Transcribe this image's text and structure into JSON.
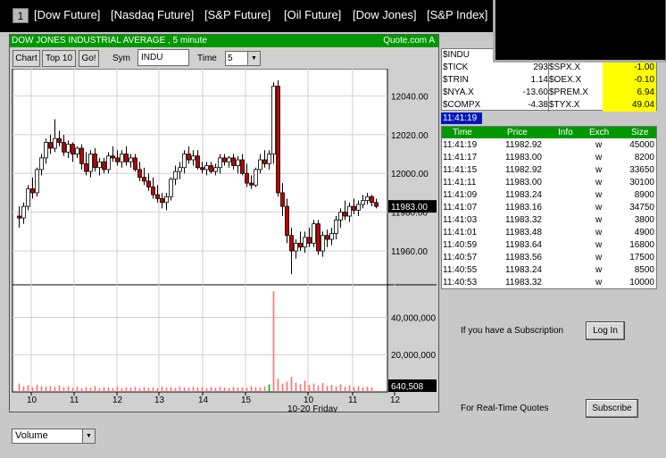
{
  "nav": {
    "tab_number": "1",
    "links": [
      "[Dow Future]",
      "[Nasdaq Future]",
      "[S&P Future]",
      "[Oil Future]",
      "[Dow Jones]",
      "[S&P Index]"
    ]
  },
  "chart_panel": {
    "title": "DOW JONES INDUSTRIAL AVERAGE  , 5 minute",
    "source": "Quote.com  A",
    "buttons": {
      "chart": "Chart",
      "top10": "Top 10",
      "go": "Go!"
    },
    "sym_label": "Sym",
    "sym_value": "INDU",
    "time_label": "Time",
    "time_value": "5",
    "indicator_select": "Volume"
  },
  "chart_data": {
    "type": "candlestick",
    "title": "DOW JONES INDUSTRIAL AVERAGE  , 5 minute",
    "price_ticks": [
      12040,
      12020,
      12000,
      11980,
      11960
    ],
    "price_tick_labels": [
      "12040.00",
      "12020.00",
      "12000.00",
      "11980.00",
      "11960.00"
    ],
    "ylim": [
      11943,
      12054
    ],
    "last_price_label": "11983.00",
    "volume_ticks": [
      40000000,
      20000000
    ],
    "volume_tick_labels": [
      "40,000,000",
      "20,000,000"
    ],
    "volume_ylim": [
      0,
      57000000
    ],
    "last_volume_label": "640,508",
    "x_tick_labels": [
      "10",
      "11",
      "12",
      "13",
      "14",
      "15",
      "10",
      "11",
      "12"
    ],
    "date_label": "10-20 Friday",
    "grid": true,
    "candles": [
      {
        "o": 11978,
        "h": 11983,
        "l": 11972,
        "c": 11977
      },
      {
        "o": 11977,
        "h": 11985,
        "l": 11974,
        "c": 11983
      },
      {
        "o": 11983,
        "h": 11994,
        "l": 11981,
        "c": 11992
      },
      {
        "o": 11992,
        "h": 11998,
        "l": 11987,
        "c": 11990
      },
      {
        "o": 11990,
        "h": 12003,
        "l": 11988,
        "c": 12002
      },
      {
        "o": 12002,
        "h": 12010,
        "l": 11999,
        "c": 12008
      },
      {
        "o": 12008,
        "h": 12018,
        "l": 12005,
        "c": 12016
      },
      {
        "o": 12016,
        "h": 12020,
        "l": 12010,
        "c": 12013
      },
      {
        "o": 12013,
        "h": 12028,
        "l": 12011,
        "c": 12018
      },
      {
        "o": 12018,
        "h": 12022,
        "l": 12014,
        "c": 12016
      },
      {
        "o": 12016,
        "h": 12020,
        "l": 12009,
        "c": 12011
      },
      {
        "o": 12011,
        "h": 12017,
        "l": 12008,
        "c": 12015
      },
      {
        "o": 12015,
        "h": 12016,
        "l": 12006,
        "c": 12010
      },
      {
        "o": 12010,
        "h": 12014,
        "l": 12008,
        "c": 12013
      },
      {
        "o": 12013,
        "h": 12015,
        "l": 12002,
        "c": 12005
      },
      {
        "o": 12005,
        "h": 12011,
        "l": 11999,
        "c": 12001
      },
      {
        "o": 12001,
        "h": 12012,
        "l": 11998,
        "c": 12010
      },
      {
        "o": 12010,
        "h": 12013,
        "l": 12001,
        "c": 12003
      },
      {
        "o": 12003,
        "h": 12008,
        "l": 11999,
        "c": 12006
      },
      {
        "o": 12006,
        "h": 12008,
        "l": 12000,
        "c": 12002
      },
      {
        "o": 12002,
        "h": 12011,
        "l": 12000,
        "c": 12009
      },
      {
        "o": 12009,
        "h": 12014,
        "l": 12006,
        "c": 12008
      },
      {
        "o": 12008,
        "h": 12012,
        "l": 12004,
        "c": 12006
      },
      {
        "o": 12006,
        "h": 12012,
        "l": 12003,
        "c": 12010
      },
      {
        "o": 12010,
        "h": 12014,
        "l": 12004,
        "c": 12006
      },
      {
        "o": 12006,
        "h": 12010,
        "l": 12003,
        "c": 12008
      },
      {
        "o": 12008,
        "h": 12010,
        "l": 12001,
        "c": 12002
      },
      {
        "o": 12002,
        "h": 12006,
        "l": 11996,
        "c": 11998
      },
      {
        "o": 11998,
        "h": 12003,
        "l": 11994,
        "c": 11996
      },
      {
        "o": 11996,
        "h": 12000,
        "l": 11991,
        "c": 11993
      },
      {
        "o": 11993,
        "h": 11998,
        "l": 11987,
        "c": 11989
      },
      {
        "o": 11989,
        "h": 11994,
        "l": 11985,
        "c": 11987
      },
      {
        "o": 11987,
        "h": 11990,
        "l": 11982,
        "c": 11985
      },
      {
        "o": 11985,
        "h": 11990,
        "l": 11981,
        "c": 11988
      },
      {
        "o": 11988,
        "h": 11998,
        "l": 11986,
        "c": 11997
      },
      {
        "o": 11997,
        "h": 12004,
        "l": 11994,
        "c": 12001
      },
      {
        "o": 12001,
        "h": 12006,
        "l": 11997,
        "c": 12003
      },
      {
        "o": 12003,
        "h": 12012,
        "l": 12000,
        "c": 12010
      },
      {
        "o": 12010,
        "h": 12014,
        "l": 12005,
        "c": 12007
      },
      {
        "o": 12007,
        "h": 12012,
        "l": 12004,
        "c": 12009
      },
      {
        "o": 12009,
        "h": 12012,
        "l": 12002,
        "c": 12003
      },
      {
        "o": 12003,
        "h": 12006,
        "l": 12000,
        "c": 12002
      },
      {
        "o": 12002,
        "h": 12006,
        "l": 11999,
        "c": 12004
      },
      {
        "o": 12004,
        "h": 12006,
        "l": 12000,
        "c": 12001
      },
      {
        "o": 12001,
        "h": 12005,
        "l": 11999,
        "c": 12003
      },
      {
        "o": 12003,
        "h": 12010,
        "l": 12000,
        "c": 12008
      },
      {
        "o": 12008,
        "h": 12010,
        "l": 12004,
        "c": 12006
      },
      {
        "o": 12006,
        "h": 12009,
        "l": 12003,
        "c": 12008
      },
      {
        "o": 12008,
        "h": 12010,
        "l": 12002,
        "c": 12004
      },
      {
        "o": 12004,
        "h": 12009,
        "l": 12000,
        "c": 12007
      },
      {
        "o": 12007,
        "h": 12010,
        "l": 11999,
        "c": 12000
      },
      {
        "o": 12000,
        "h": 12005,
        "l": 11993,
        "c": 11995
      },
      {
        "o": 11995,
        "h": 11999,
        "l": 11992,
        "c": 11994
      },
      {
        "o": 11994,
        "h": 12003,
        "l": 11993,
        "c": 12002
      },
      {
        "o": 12002,
        "h": 12010,
        "l": 12000,
        "c": 12007
      },
      {
        "o": 12007,
        "h": 12012,
        "l": 12003,
        "c": 12005
      },
      {
        "o": 12005,
        "h": 12012,
        "l": 12002,
        "c": 12010
      },
      {
        "o": 12010,
        "h": 12047,
        "l": 12005,
        "c": 12045
      },
      {
        "o": 12045,
        "h": 12048,
        "l": 11988,
        "c": 11990
      },
      {
        "o": 11990,
        "h": 11995,
        "l": 11978,
        "c": 11983
      },
      {
        "o": 11983,
        "h": 11987,
        "l": 11964,
        "c": 11968
      },
      {
        "o": 11968,
        "h": 11972,
        "l": 11948,
        "c": 11960
      },
      {
        "o": 11960,
        "h": 11966,
        "l": 11956,
        "c": 11964
      },
      {
        "o": 11964,
        "h": 11970,
        "l": 11960,
        "c": 11962
      },
      {
        "o": 11962,
        "h": 11970,
        "l": 11959,
        "c": 11967
      },
      {
        "o": 11967,
        "h": 11972,
        "l": 11962,
        "c": 11964
      },
      {
        "o": 11964,
        "h": 11976,
        "l": 11962,
        "c": 11974
      },
      {
        "o": 11974,
        "h": 11976,
        "l": 11958,
        "c": 11960
      },
      {
        "o": 11960,
        "h": 11970,
        "l": 11957,
        "c": 11968
      },
      {
        "o": 11968,
        "h": 11971,
        "l": 11962,
        "c": 11966
      },
      {
        "o": 11966,
        "h": 11972,
        "l": 11963,
        "c": 11969
      },
      {
        "o": 11969,
        "h": 11978,
        "l": 11966,
        "c": 11976
      },
      {
        "o": 11976,
        "h": 11982,
        "l": 11972,
        "c": 11980
      },
      {
        "o": 11980,
        "h": 11986,
        "l": 11976,
        "c": 11978
      },
      {
        "o": 11978,
        "h": 11985,
        "l": 11975,
        "c": 11983
      },
      {
        "o": 11983,
        "h": 11987,
        "l": 11979,
        "c": 11981
      },
      {
        "o": 11981,
        "h": 11986,
        "l": 11978,
        "c": 11984
      },
      {
        "o": 11984,
        "h": 11989,
        "l": 11982,
        "c": 11986
      },
      {
        "o": 11986,
        "h": 11990,
        "l": 11984,
        "c": 11988
      },
      {
        "o": 11988,
        "h": 11989,
        "l": 11983,
        "c": 11985
      },
      {
        "o": 11985,
        "h": 11987,
        "l": 11982,
        "c": 11983
      }
    ],
    "volume": [
      4500000,
      3000000,
      3600000,
      2500000,
      3800000,
      3000000,
      2800000,
      3200000,
      2600000,
      3500000,
      2400000,
      3000000,
      2200000,
      2800000,
      2000000,
      2600000,
      2300000,
      3100000,
      2100000,
      2600000,
      2400000,
      2200000,
      2800000,
      2000000,
      2500000,
      2300000,
      2700000,
      2100000,
      2600000,
      2200000,
      2400000,
      2000000,
      2800000,
      2300000,
      2500000,
      2100000,
      2900000,
      2400000,
      2200000,
      2700000,
      2300000,
      2500000,
      2000000,
      2600000,
      2200000,
      2800000,
      2400000,
      2100000,
      2700000,
      2300000,
      2500000,
      2200000,
      3000000,
      2600000,
      2400000,
      2900000,
      4000000,
      54000000,
      7000000,
      4500000,
      5500000,
      8000000,
      5000000,
      4200000,
      6000000,
      3800000,
      4500000,
      3500000,
      4800000,
      3200000,
      3800000,
      3000000,
      4200000,
      2800000,
      3500000,
      2600000,
      3000000,
      2500000,
      2800000,
      2400000,
      640508
    ]
  },
  "index_quotes": [
    {
      "sym": "$INDU",
      "val": "",
      "sym2": "",
      "val2": "",
      "hl": false
    },
    {
      "sym": "$TICK",
      "val": "293",
      "sym2": "$SPX.X",
      "val2": "-1.00",
      "hl": true
    },
    {
      "sym": "$TRIN",
      "val": "1.14",
      "sym2": "$OEX.X",
      "val2": "-0.10",
      "hl": true
    },
    {
      "sym": "$NYA.X",
      "val": "-13.60",
      "sym2": "$PREM.X",
      "val2": "6.94",
      "hl": true
    },
    {
      "sym": "$COMPX",
      "val": "-4.38",
      "sym2": "$TYX.X",
      "val2": "49.04",
      "hl": true
    }
  ],
  "current_time": "11:41:19",
  "tape": {
    "headers": {
      "time": "Time",
      "price": "Price",
      "info": "Info",
      "exch": "Exch",
      "size": "Size"
    },
    "rows": [
      {
        "time": "11:41:19",
        "price": "11982.92",
        "exch": "w",
        "size": "45000"
      },
      {
        "time": "11:41:17",
        "price": "11983.00",
        "exch": "w",
        "size": "8200"
      },
      {
        "time": "11:41:15",
        "price": "11982.92",
        "exch": "w",
        "size": "33650"
      },
      {
        "time": "11:41:11",
        "price": "11983.00",
        "exch": "w",
        "size": "30100"
      },
      {
        "time": "11:41:09",
        "price": "11983.24",
        "exch": "w",
        "size": "8900"
      },
      {
        "time": "11:41:07",
        "price": "11983.16",
        "exch": "w",
        "size": "34750"
      },
      {
        "time": "11:41:03",
        "price": "11983.32",
        "exch": "w",
        "size": "3800"
      },
      {
        "time": "11:41:01",
        "price": "11983.48",
        "exch": "w",
        "size": "4900"
      },
      {
        "time": "11:40:59",
        "price": "11983.64",
        "exch": "w",
        "size": "16800"
      },
      {
        "time": "11:40:57",
        "price": "11983.56",
        "exch": "w",
        "size": "17500"
      },
      {
        "time": "11:40:55",
        "price": "11983.24",
        "exch": "w",
        "size": "8500"
      },
      {
        "time": "11:40:53",
        "price": "11983.32",
        "exch": "w",
        "size": "10000"
      }
    ]
  },
  "subscription": {
    "login_text": "If you have a Subscription",
    "login_button": "Log In",
    "subscribe_text": "For Real-Time Quotes",
    "subscribe_button": "Subscribe"
  },
  "colors": {
    "up": "#ffffff",
    "down": "#c00000",
    "header_green": "#009800",
    "highlight_yellow": "#ffff00",
    "volume": "#ff6e6e"
  }
}
